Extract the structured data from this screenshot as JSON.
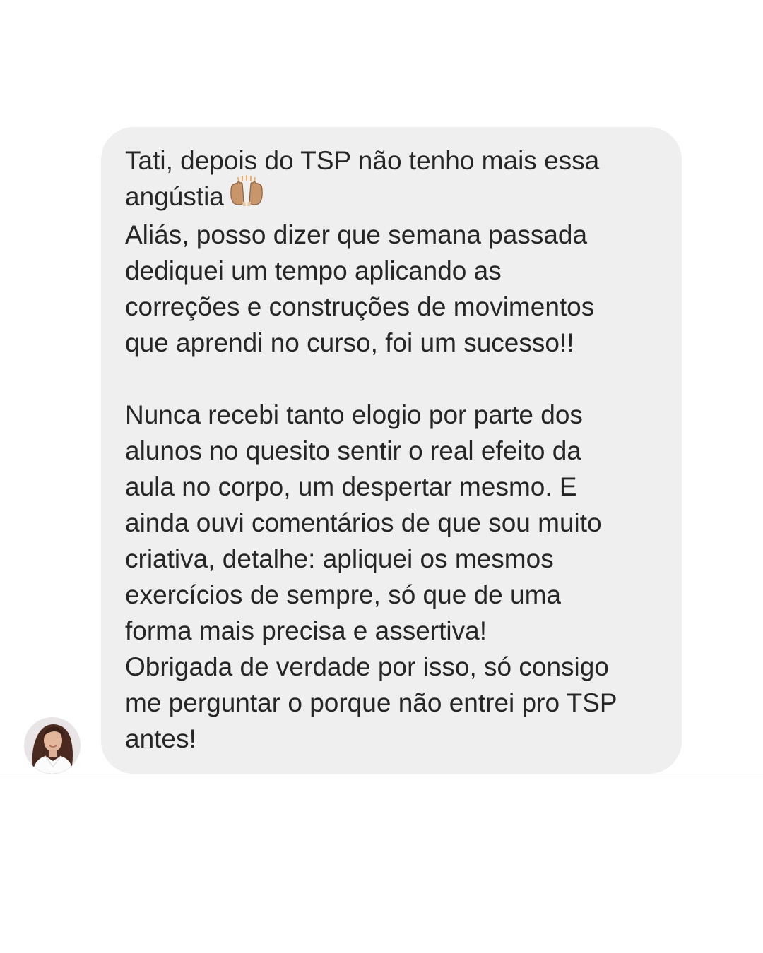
{
  "message": {
    "lines": [
      "Tati, depois do TSP não tenho mais essa",
      "angústia",
      "Aliás, posso dizer que semana passada",
      "dediquei um tempo aplicando as",
      "correções e construções de movimentos",
      "que aprendi no curso, foi um sucesso!!",
      "",
      "Nunca recebi tanto elogio por parte dos",
      "alunos no quesito sentir o real efeito da",
      "aula no corpo, um despertar mesmo. E",
      "ainda ouvi comentários de que sou muito",
      "criativa, detalhe: apliquei os mesmos",
      "exercícios de sempre, só que de uma",
      "forma mais precisa e assertiva!",
      "Obrigada de verdade por isso, só consigo",
      "me perguntar o porque não entrei pro TSP",
      "antes!"
    ],
    "emoji": "raising-hands-icon"
  },
  "colors": {
    "page_background": "#ffffff",
    "bubble_background": "#efefef",
    "text": "#262626",
    "divider": "#9a9a9a"
  }
}
